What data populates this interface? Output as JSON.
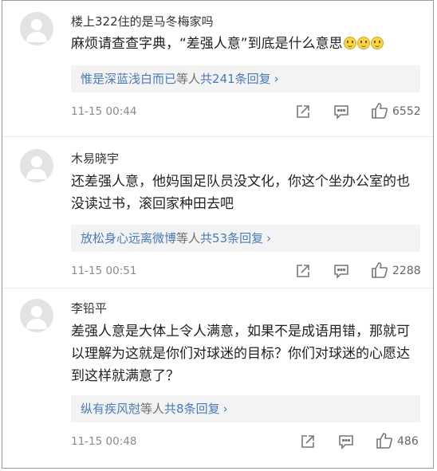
{
  "comments": [
    {
      "username": "楼上322住的是马冬梅家吗",
      "text": "麻烦请查查字典，“差强人意”到底是什么意思",
      "emoji_count": 3,
      "reply_user": "惟是深蓝浅白而已",
      "reply_mid": "等人",
      "reply_count": "共241条回复",
      "reply_chevron": "›",
      "time": "11-15 00:44",
      "likes": "6552"
    },
    {
      "username": "木易晓宇",
      "text": "还差强人意，他妈国足队员没文化，你这个坐办公室的也没读过书，滚回家种田去吧",
      "reply_user": "放松身心远离微博",
      "reply_mid": "等人",
      "reply_count": "共53条回复",
      "reply_chevron": "›",
      "time": "11-15 00:51",
      "likes": "2288"
    },
    {
      "username": "李铅平",
      "text": "差强人意是大体上令人满意，如果不是成语用错，那就可以理解为这就是你们对球迷的目标？你们对球迷的心愿达到这样就满意了？",
      "reply_user": "纵有疾风尅",
      "reply_mid": "等人",
      "reply_count": "共8条回复",
      "reply_chevron": "›",
      "time": "11-15 00:48",
      "likes": "486"
    }
  ],
  "icons": {
    "share": "share-icon",
    "comment": "comment-icon",
    "like": "thumbs-up-icon",
    "avatar": "default-avatar-icon"
  },
  "colors": {
    "link_blue": "#4a7bb8",
    "reply_bg": "#f3f3f3",
    "meta_gray": "#8a8a8a"
  }
}
